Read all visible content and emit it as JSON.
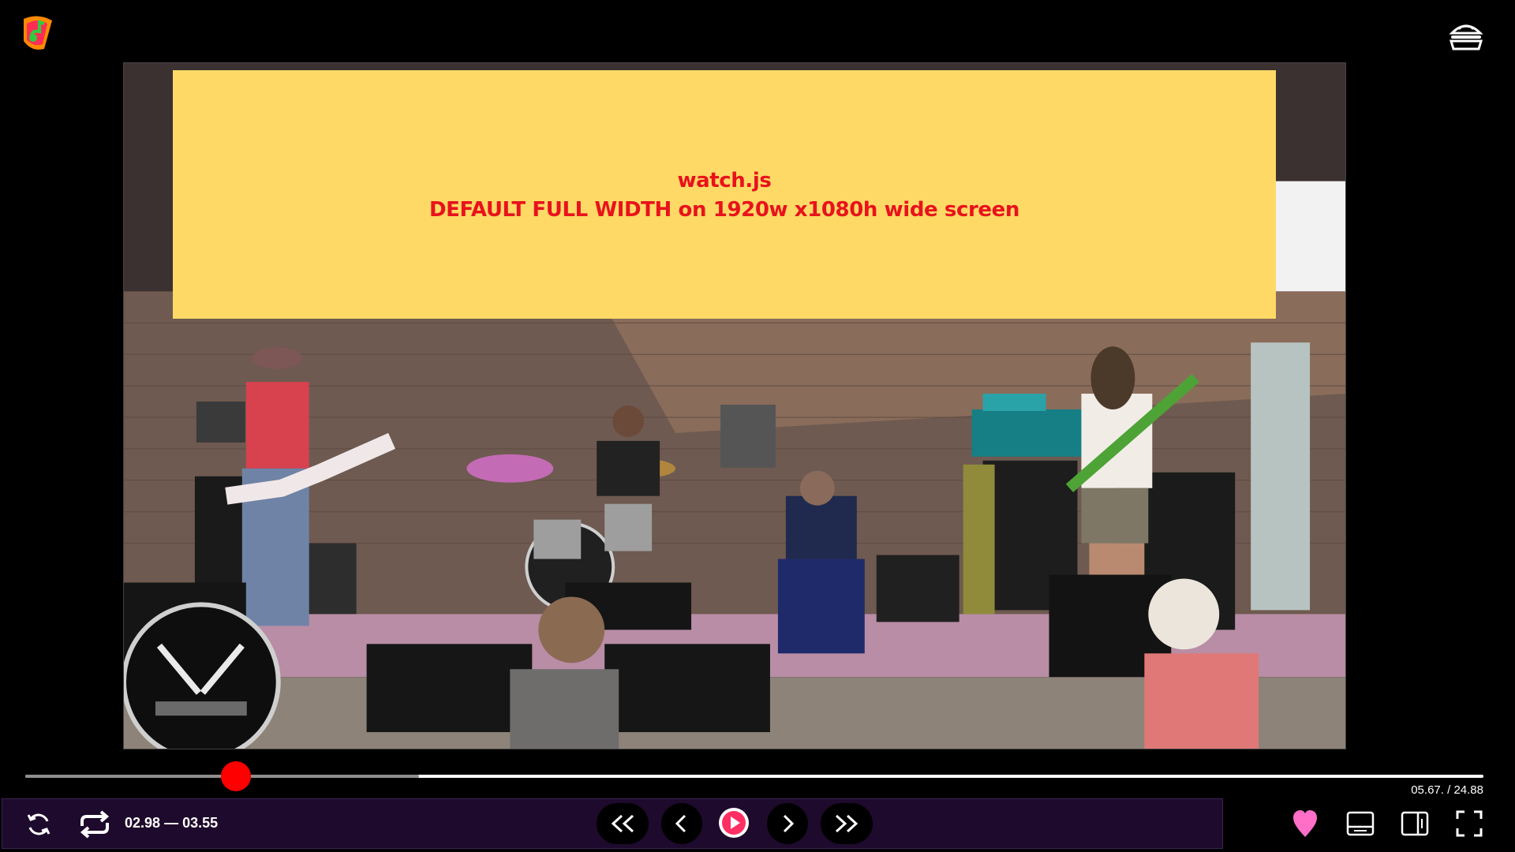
{
  "app": {
    "logo_icon": "music-note-logo-icon",
    "menu_icon": "hamburger-menu-icon"
  },
  "overlay": {
    "line1": "watch.js",
    "line2": "DEFAULT FULL WIDTH on 1920w x1080h wide screen",
    "background": "#fed966",
    "text_color": "#e8121c"
  },
  "video": {
    "description_icon": "concert-video-frame"
  },
  "progress": {
    "played_fraction": 0.12,
    "buffered_fraction": 0.27,
    "thumb_color": "#ff0000"
  },
  "time": {
    "current": "05.67.",
    "separator": "/",
    "total": "24.88"
  },
  "controls": {
    "loop_range": {
      "start": "02.98",
      "dash": "—",
      "end": "03.55"
    },
    "icons": [
      "reload-icon",
      "repeat-icon",
      "rewind-fast-icon",
      "step-back-icon",
      "play-icon",
      "step-forward-icon",
      "forward-fast-icon"
    ],
    "right_icons": [
      "heart-icon",
      "layout-bottom-panel-icon",
      "layout-right-panel-icon",
      "fullscreen-icon"
    ],
    "accent": "#ff2e63",
    "heart_color": "#ff6ec7"
  }
}
